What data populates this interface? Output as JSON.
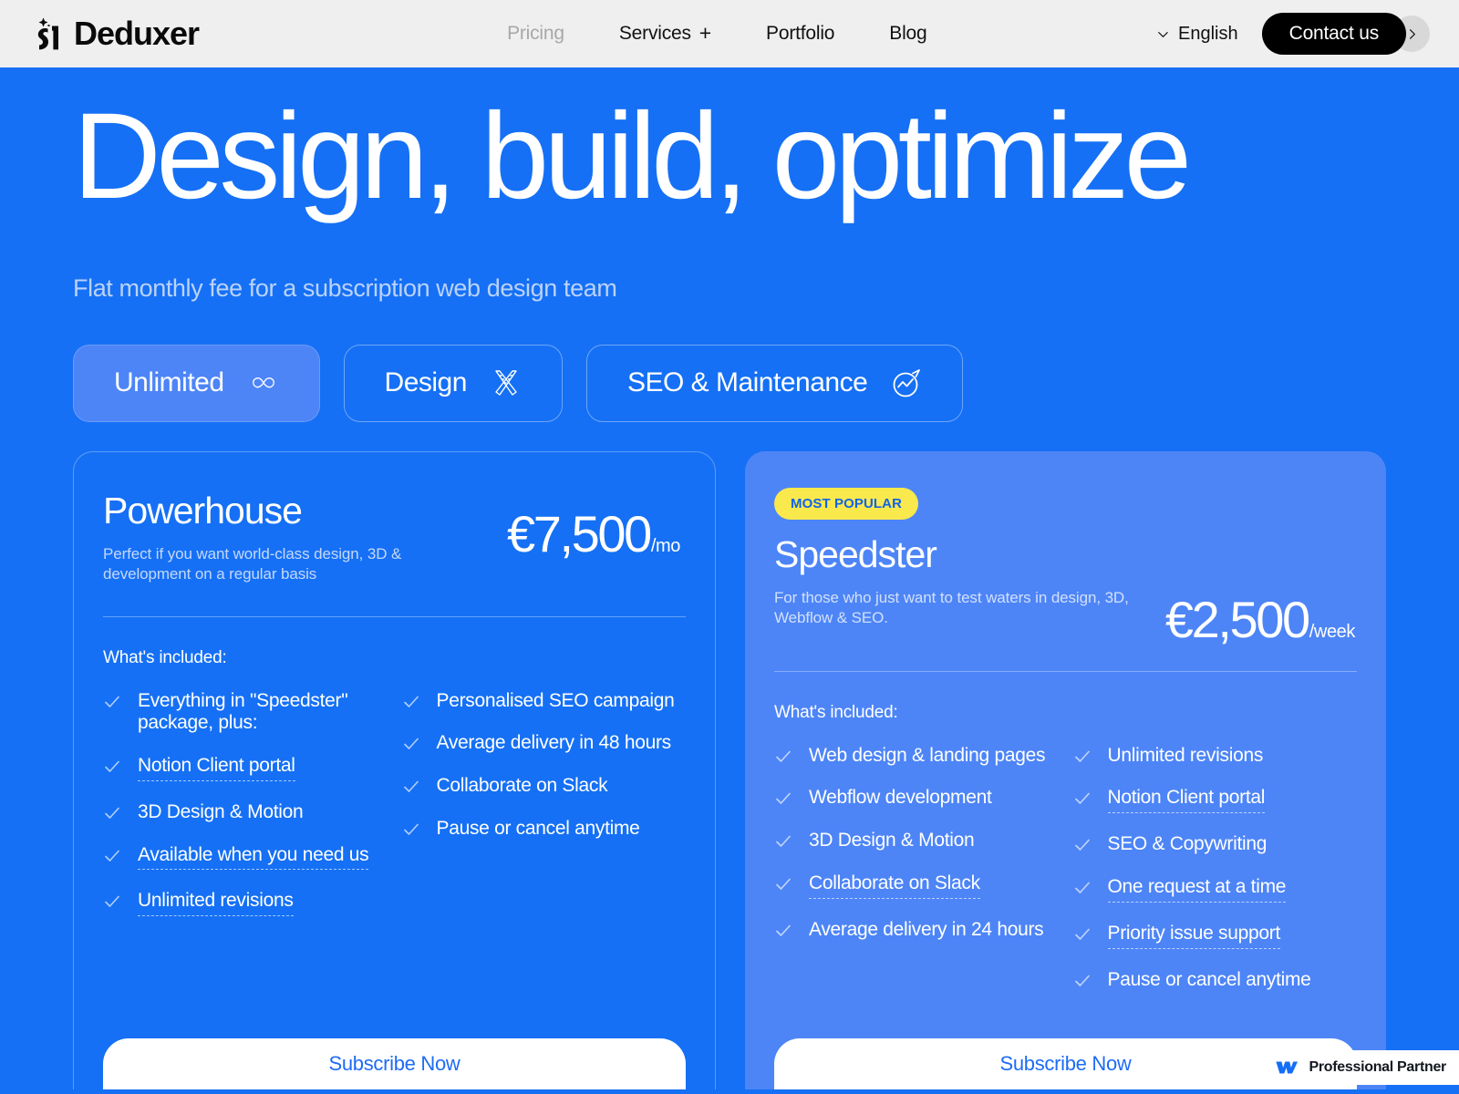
{
  "header": {
    "brand_name": "Deduxer",
    "brand_icon": "deduxer-logo-mark",
    "nav": [
      {
        "label": "Pricing",
        "muted": true,
        "has_plus": false
      },
      {
        "label": "Services",
        "muted": false,
        "has_plus": true,
        "plus": "+"
      },
      {
        "label": "Portfolio",
        "muted": false,
        "has_plus": false
      },
      {
        "label": "Blog",
        "muted": false,
        "has_plus": false
      }
    ],
    "language": "English",
    "language_icon": "chevron-down-icon",
    "cta_label": "Contact us",
    "cta_arrow_icon": "chevron-right-icon"
  },
  "hero": {
    "title": "Design, build, optimize",
    "subtitle": "Flat monthly fee for a subscription web design team"
  },
  "tabs": [
    {
      "label": "Unlimited",
      "icon": "infinity-icon",
      "active": true
    },
    {
      "label": "Design",
      "icon": "crossed-tools-icon",
      "active": false
    },
    {
      "label": "SEO & Maintenance",
      "icon": "trending-chart-circle-icon",
      "active": false
    }
  ],
  "plans": [
    {
      "name": "Powerhouse",
      "description": "Perfect if you want world-class design, 3D & development on a regular basis",
      "price": "€7,500",
      "period": "/mo",
      "badge": null,
      "featured": false,
      "included_label": "What's included:",
      "features_left": [
        {
          "text": "Everything in \"Speedster\" package, plus:",
          "tooltip": false
        },
        {
          "text": "Notion Client portal",
          "tooltip": true
        },
        {
          "text": "3D Design & Motion",
          "tooltip": false
        },
        {
          "text": "Available when you need us",
          "tooltip": true
        },
        {
          "text": "Unlimited revisions",
          "tooltip": true
        }
      ],
      "features_right": [
        {
          "text": "Personalised SEO campaign",
          "tooltip": false
        },
        {
          "text": "Average delivery in 48 hours",
          "tooltip": false
        },
        {
          "text": "Collaborate on Slack",
          "tooltip": false
        },
        {
          "text": "Pause or cancel anytime",
          "tooltip": false
        }
      ],
      "cta_label": "Subscribe Now"
    },
    {
      "name": "Speedster",
      "description": "For those who just want to test waters in design, 3D, Webflow & SEO.",
      "price": "€2,500",
      "period": "/week",
      "badge": "MOST POPULAR",
      "featured": true,
      "included_label": "What's included:",
      "features_left": [
        {
          "text": "Web design & landing pages",
          "tooltip": false
        },
        {
          "text": "Webflow development",
          "tooltip": false
        },
        {
          "text": "3D Design & Motion",
          "tooltip": false
        },
        {
          "text": "Collaborate on Slack",
          "tooltip": true
        },
        {
          "text": "Average delivery in 24 hours",
          "tooltip": false
        }
      ],
      "features_right": [
        {
          "text": "Unlimited revisions",
          "tooltip": false
        },
        {
          "text": "Notion Client portal",
          "tooltip": true
        },
        {
          "text": "SEO & Copywriting",
          "tooltip": false
        },
        {
          "text": "One request at a time",
          "tooltip": true
        },
        {
          "text": "Priority issue support",
          "tooltip": true
        },
        {
          "text": "Pause or cancel anytime",
          "tooltip": false
        }
      ],
      "cta_label": "Subscribe Now"
    }
  ],
  "webflow_badge": {
    "text": "Professional Partner",
    "icon": "webflow-logo-icon"
  },
  "colors": {
    "page_blue": "#1570F5",
    "featured_blue": "#4D85F7",
    "badge_yellow": "#FAE94D",
    "badge_text_blue": "#1064E8",
    "header_bg": "#EFEFEF",
    "cta_black": "#000000",
    "button_white": "#FFFFFF",
    "subtitle_blue": "#BBD2FB"
  }
}
